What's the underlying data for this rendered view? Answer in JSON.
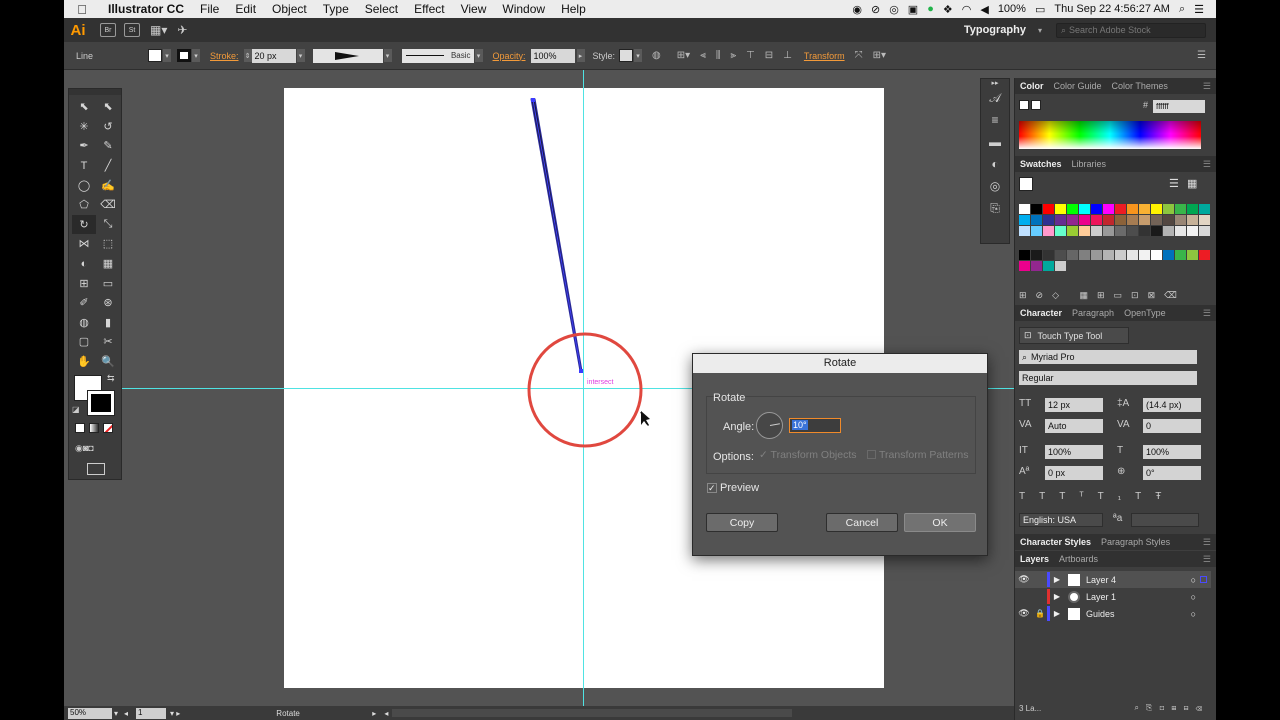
{
  "menubar": {
    "app_name": "Illustrator CC",
    "items": [
      "File",
      "Edit",
      "Object",
      "Type",
      "Select",
      "Effect",
      "View",
      "Window",
      "Help"
    ],
    "battery": "100%",
    "clock": "Thu Sep 22  4:56:27 AM"
  },
  "appbar": {
    "logo": "Ai",
    "bridge": "Br",
    "stock": "St",
    "workspace": "Typography",
    "search_placeholder": "Search Adobe Stock"
  },
  "control_bar": {
    "object_type": "Line",
    "stroke_label": "Stroke:",
    "stroke_weight": "20 px",
    "profile_label": "Basic",
    "opacity_label": "Opacity:",
    "opacity_value": "100%",
    "style_label": "Style:",
    "transform_label": "Transform"
  },
  "tools": {
    "icons": [
      "selection-icon",
      "direct-selection-icon",
      "magic-wand-icon",
      "lasso-icon",
      "pen-icon",
      "curvature-icon",
      "type-icon",
      "line-segment-icon",
      "ellipse-icon",
      "paintbrush-icon",
      "shaper-icon",
      "eraser-icon",
      "rotate-icon",
      "scale-icon",
      "width-icon",
      "free-transform-icon",
      "shape-builder-icon",
      "perspective-grid-icon",
      "mesh-icon",
      "gradient-icon",
      "eyedropper-icon",
      "blend-icon",
      "symbol-sprayer-icon",
      "column-graph-icon",
      "artboard-icon",
      "slice-icon",
      "hand-icon",
      "zoom-icon"
    ],
    "glyphs": [
      "⬉",
      "⬉",
      "✳",
      "↺",
      "✒",
      "✎",
      "T",
      "╱",
      "◯",
      "✍",
      "⬠",
      "⌫",
      "↻",
      "⤡",
      "⋈",
      "⬚",
      "◐",
      "▦",
      "⊞",
      "▭",
      "✐",
      "⊛",
      "◍",
      "▮",
      "▢",
      "✂",
      "✋",
      "🔍"
    ]
  },
  "canvas": {
    "smart_guide_label": "intersect"
  },
  "rotate_dialog": {
    "title": "Rotate",
    "group_title": "Rotate",
    "angle_label": "Angle:",
    "angle_value": "10°",
    "options_label": "Options:",
    "transform_objects": "Transform Objects",
    "transform_patterns": "Transform Patterns",
    "preview_label": "Preview",
    "copy_label": "Copy",
    "cancel_label": "Cancel",
    "ok_label": "OK"
  },
  "color_panel": {
    "tabs": [
      "Color",
      "Color Guide",
      "Color Themes"
    ],
    "hex": "ffffff"
  },
  "swatches_panel": {
    "tabs": [
      "Swatches",
      "Libraries"
    ]
  },
  "character_panel": {
    "tabs": [
      "Character",
      "Paragraph",
      "OpenType"
    ],
    "touch_type": "Touch Type Tool",
    "font_family": "Myriad Pro",
    "font_style": "Regular",
    "font_size": "12 px",
    "leading": "(14.4 px)",
    "kerning": "Auto",
    "tracking": "0",
    "vertical_scale": "100%",
    "horizontal_scale": "100%",
    "baseline_shift": "0 px",
    "rotation": "0°",
    "language": "English: USA"
  },
  "char_styles_panel": {
    "tabs": [
      "Character Styles",
      "Paragraph Styles"
    ]
  },
  "layers_panel": {
    "tabs": [
      "Layers",
      "Artboards"
    ],
    "layers": [
      "Layer 4",
      "Layer 1",
      "Guides"
    ],
    "count": "3 La..."
  },
  "status_bar": {
    "zoom": "50%",
    "artboard_num": "1",
    "current_tool": "Rotate"
  },
  "colors": {
    "accent_orange": "#f29a3a",
    "guide_cyan": "#4fe3e3",
    "circle_red": "#e0483f"
  }
}
